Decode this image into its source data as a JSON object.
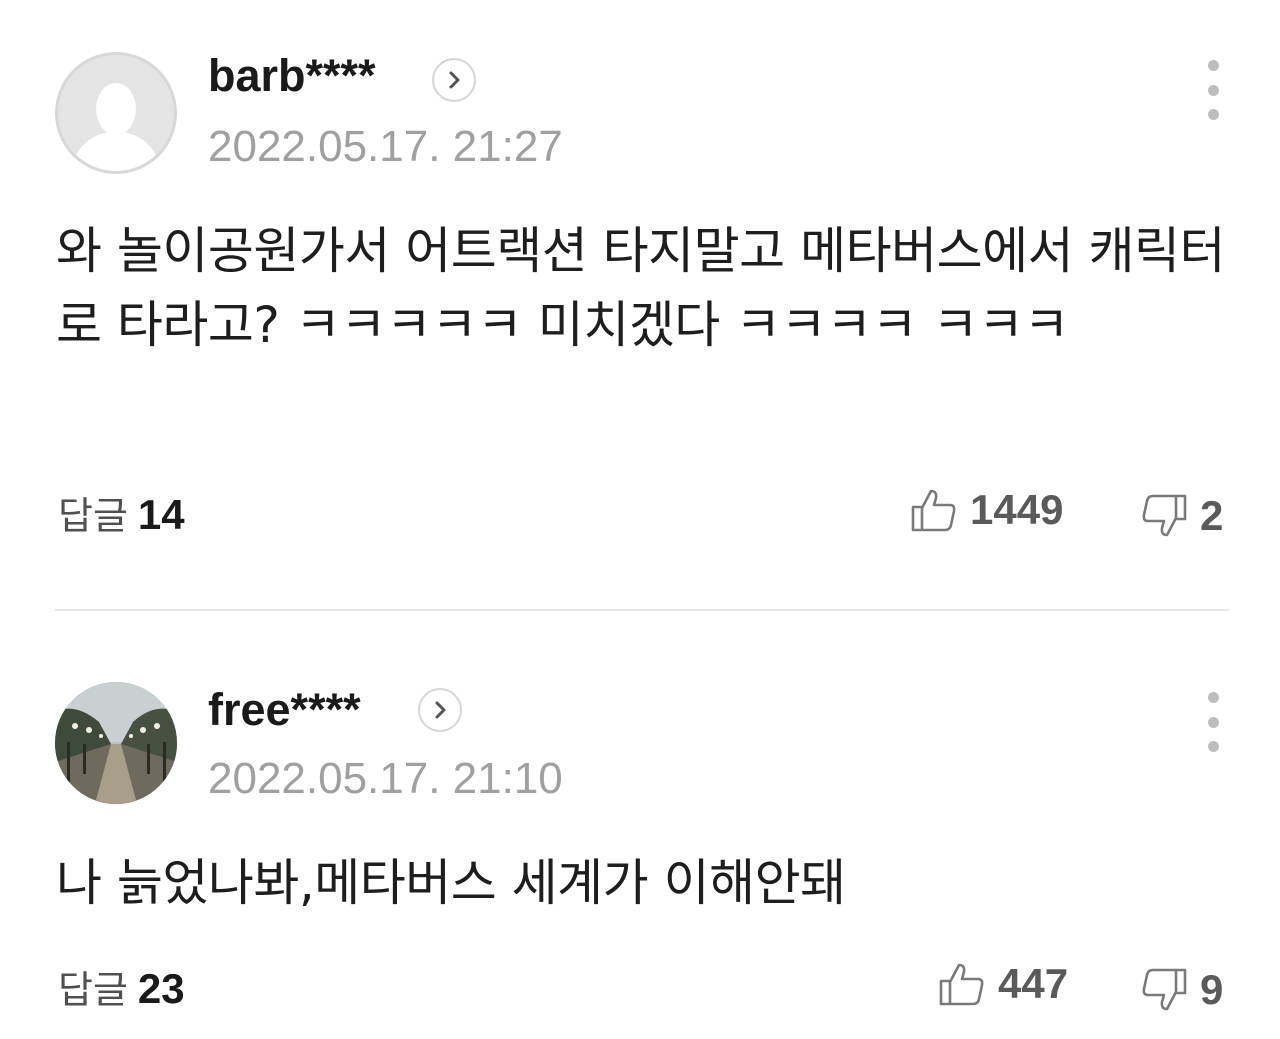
{
  "comments": [
    {
      "username": "barb****",
      "timestamp": "2022.05.17. 21:27",
      "text": "와 놀이공원가서 어트랙션 타지말고 메타버스에서 캐릭터로 타라고? ㅋㅋㅋㅋㅋ 미치겠다 ㅋㅋㅋㅋ ㅋㅋㅋ",
      "reply_label": "답글",
      "reply_count": "14",
      "likes": "1449",
      "dislikes": "2",
      "avatar": "default-avatar-icon"
    },
    {
      "username": "free****",
      "timestamp": "2022.05.17. 21:10",
      "text": "나 늙었나봐,메타버스 세계가 이해안돼",
      "reply_label": "답글",
      "reply_count": "23",
      "likes": "447",
      "dislikes": "9",
      "avatar": "tree-lined-path-photo"
    }
  ],
  "icons": {
    "profile_arrow": "chevron-right-icon",
    "more": "more-vertical-icon",
    "like": "thumbs-up-icon",
    "dislike": "thumbs-down-icon"
  },
  "colors": {
    "text": "#1e1e1e",
    "meta": "#a0a0a0",
    "vote_count": "#5a5a5a",
    "divider": "#e8e8e8"
  }
}
